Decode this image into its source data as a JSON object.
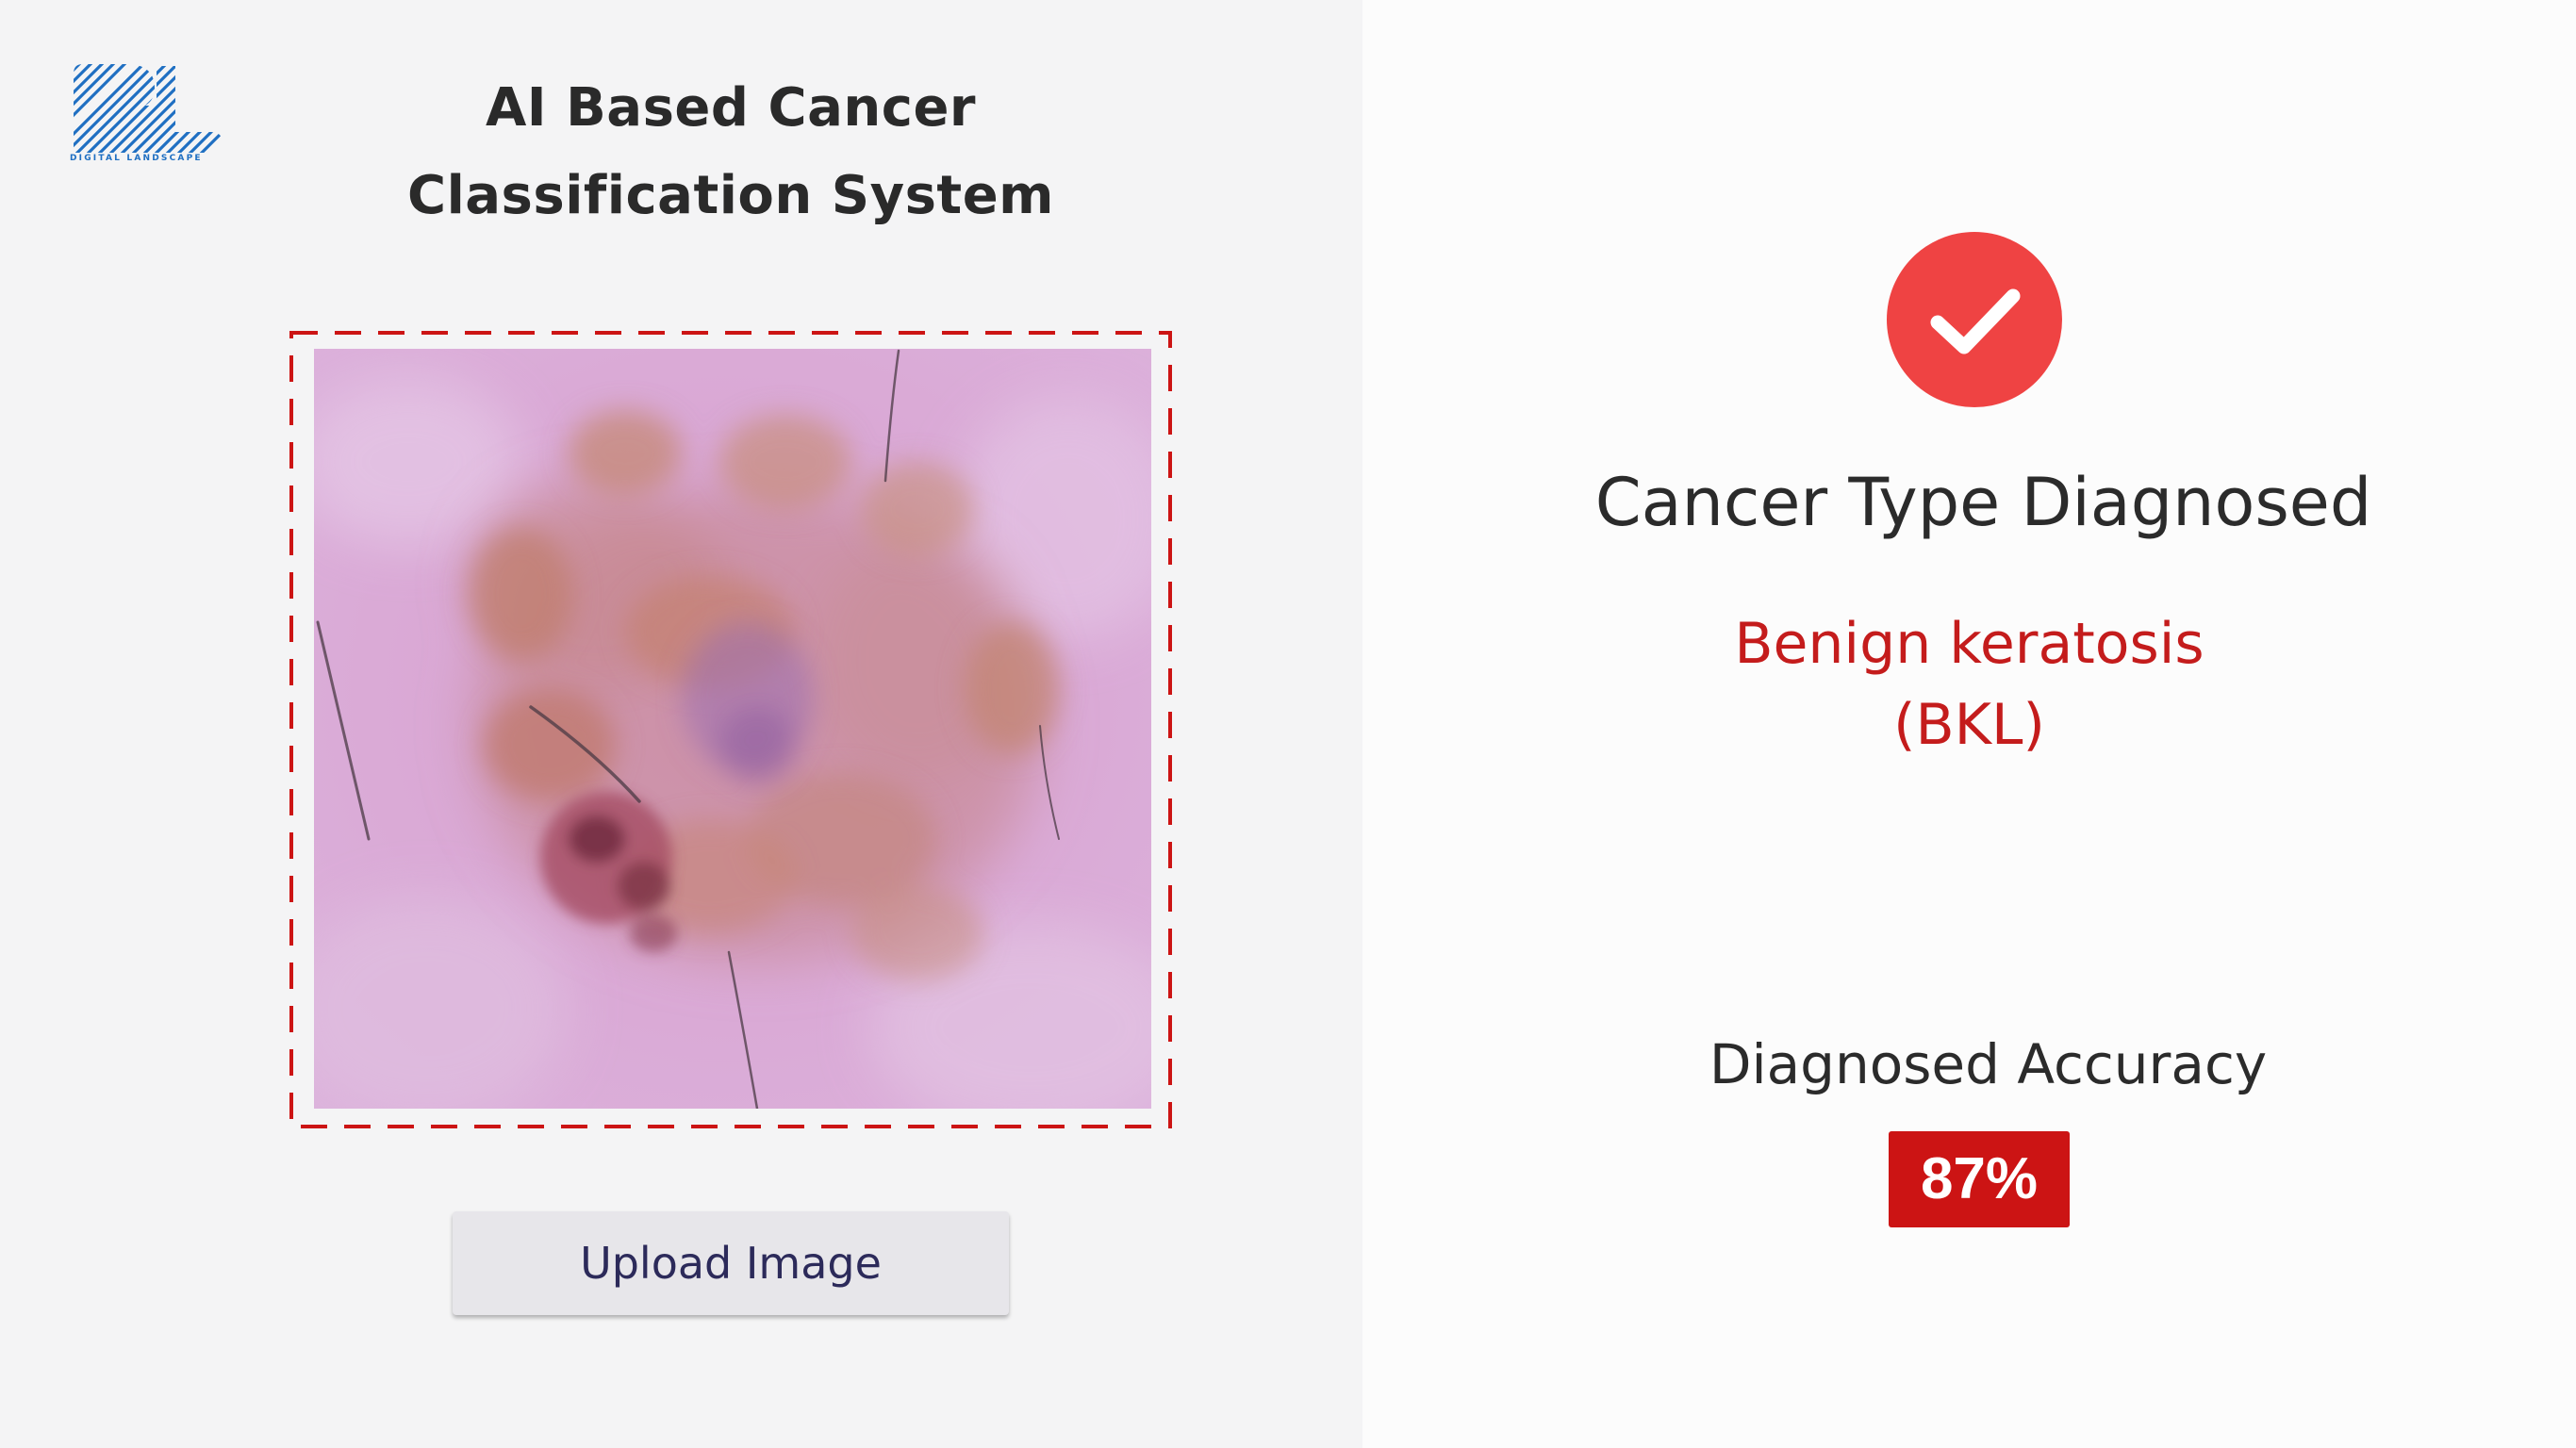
{
  "brand": {
    "logo_icon": "digital-landscape-logo",
    "logo_text": "DIGITAL LANDSCAPE",
    "color": "#1f6fc2"
  },
  "header": {
    "title_line1": "AI Based Cancer",
    "title_line2": "Classification System"
  },
  "upload": {
    "button_label": "Upload Image",
    "image_subject": "dermoscopic skin lesion",
    "border_color": "#cc1414"
  },
  "result": {
    "status_icon": "check-circle-icon",
    "status_color": "#ef4343",
    "heading": "Cancer Type Diagnosed",
    "diagnosis_name": "Benign keratosis",
    "diagnosis_code": "(BKL)",
    "diagnosis_color": "#c41c1c",
    "accuracy_label": "Diagnosed Accuracy",
    "accuracy_value": "87%",
    "accuracy_color": "#cc1414"
  }
}
